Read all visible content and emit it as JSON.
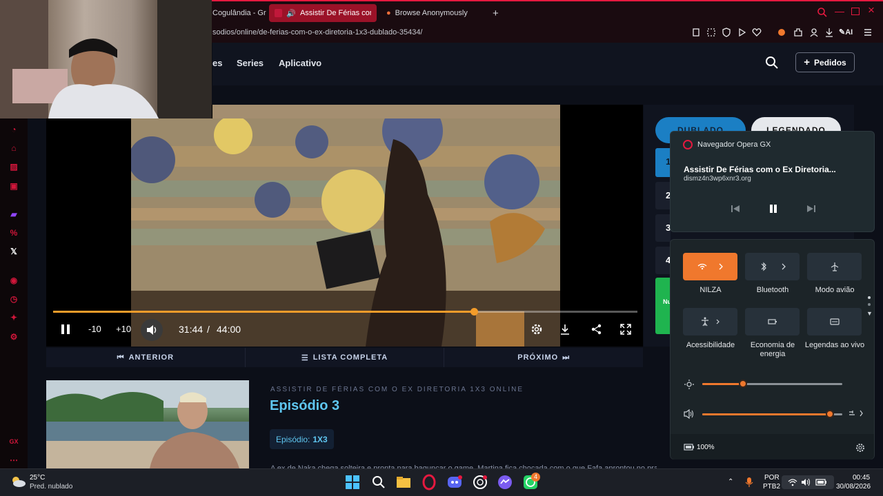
{
  "browser": {
    "tabs": [
      {
        "label": "Cogulândia - Gr"
      },
      {
        "label": "Assistir De Férias com"
      },
      {
        "label": "Browse Anonymously"
      }
    ],
    "url": "sodios/online/de-ferias-com-o-ex-diretoria-1x3-dublado-35434/",
    "ai_label": "AI"
  },
  "site": {
    "nav": [
      "es",
      "Series",
      "Aplicativo"
    ],
    "pedidos_label": "Pedidos"
  },
  "player": {
    "rewind_label": "-10",
    "forward_label": "+10",
    "current_time": "31:44",
    "separator": "/",
    "duration": "44:00",
    "progress": 0.72,
    "accent": "#f39c2a"
  },
  "episode_nav": {
    "prev": "ANTERIOR",
    "list": "LISTA COMPLETA",
    "next": "PRÓXIMO"
  },
  "episode": {
    "subtitle": "ASSISTIR DE FÉRIAS COM O EX DIRETORIA 1X3 ONLINE",
    "title": "Episódio 3",
    "badge_label": "Episódio:",
    "badge_value": "1X3",
    "description": "A ex de Naka chega solteira e pronta para bagunçar o game. Martina fica chocada com o que Fafa aprontou no praia. E todos ficam de cara com..."
  },
  "side": {
    "dublado": "DUBLADO",
    "legendado": "LEGENDADO",
    "visible_digits": [
      "1",
      "2",
      "3",
      "4"
    ],
    "green_label": "Nu"
  },
  "media_flyout": {
    "app": "Navegador Opera GX",
    "title": "Assistir De Férias com o Ex Diretoria...",
    "domain": "dismz4n3wp6xnr3.org"
  },
  "quick_settings": {
    "tiles": [
      {
        "label": "NILZA",
        "icon": "wifi-icon",
        "on": true
      },
      {
        "label": "Bluetooth",
        "icon": "bluetooth-icon",
        "on": false
      },
      {
        "label": "Modo avião",
        "icon": "airplane-icon",
        "on": false
      },
      {
        "label": "Acessibilidade",
        "icon": "accessibility-icon",
        "on": false
      },
      {
        "label": "Economia de energia",
        "icon": "battery-saver-icon",
        "on": false
      },
      {
        "label": "Legendas ao vivo",
        "icon": "captions-icon",
        "on": false
      }
    ],
    "brightness": 0.29,
    "volume": 0.91,
    "battery": "100%"
  },
  "taskbar": {
    "weather_temp": "25°C",
    "weather_desc": "Pred. nublado",
    "lang_1": "POR",
    "lang_2": "PTB2",
    "time": "00:45",
    "date": "30/08/2026",
    "whatsapp_badge": "4"
  }
}
